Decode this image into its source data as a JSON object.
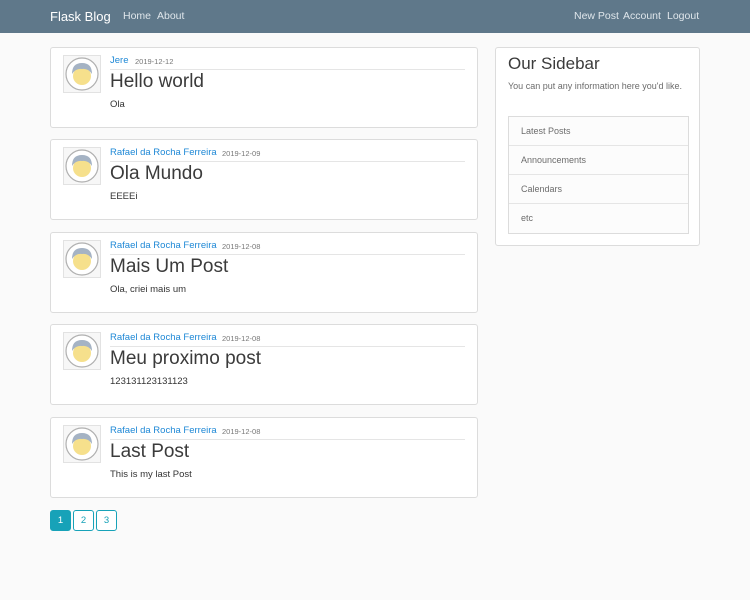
{
  "navbar": {
    "brand": "Flask Blog",
    "home": "Home",
    "about": "About",
    "new_post": "New Post",
    "account": "Account",
    "logout": "Logout"
  },
  "posts": [
    {
      "author": "Jere",
      "date": "2019-12-12",
      "title": "Hello world",
      "content": "Ola"
    },
    {
      "author": "Rafael da Rocha Ferreira",
      "date": "2019-12-09",
      "title": "Ola Mundo",
      "content": "EEEEi"
    },
    {
      "author": "Rafael da Rocha Ferreira",
      "date": "2019-12-08",
      "title": "Mais Um Post",
      "content": "Ola, criei mais um"
    },
    {
      "author": "Rafael da Rocha Ferreira",
      "date": "2019-12-08",
      "title": "Meu proximo post",
      "content": "123131123131123"
    },
    {
      "author": "Rafael da Rocha Ferreira",
      "date": "2019-12-08",
      "title": "Last Post",
      "content": "This is my last Post"
    }
  ],
  "sidebar": {
    "title": "Our Sidebar",
    "description": "You can put any information here you'd like.",
    "items": [
      "Latest Posts",
      "Announcements",
      "Calendars",
      "etc"
    ]
  },
  "pagination": {
    "pages": [
      "1",
      "2",
      "3"
    ],
    "active": "1"
  },
  "colors": {
    "navbar": "#5f788a",
    "link": "#1e88d6",
    "accent": "#17a2b8"
  }
}
